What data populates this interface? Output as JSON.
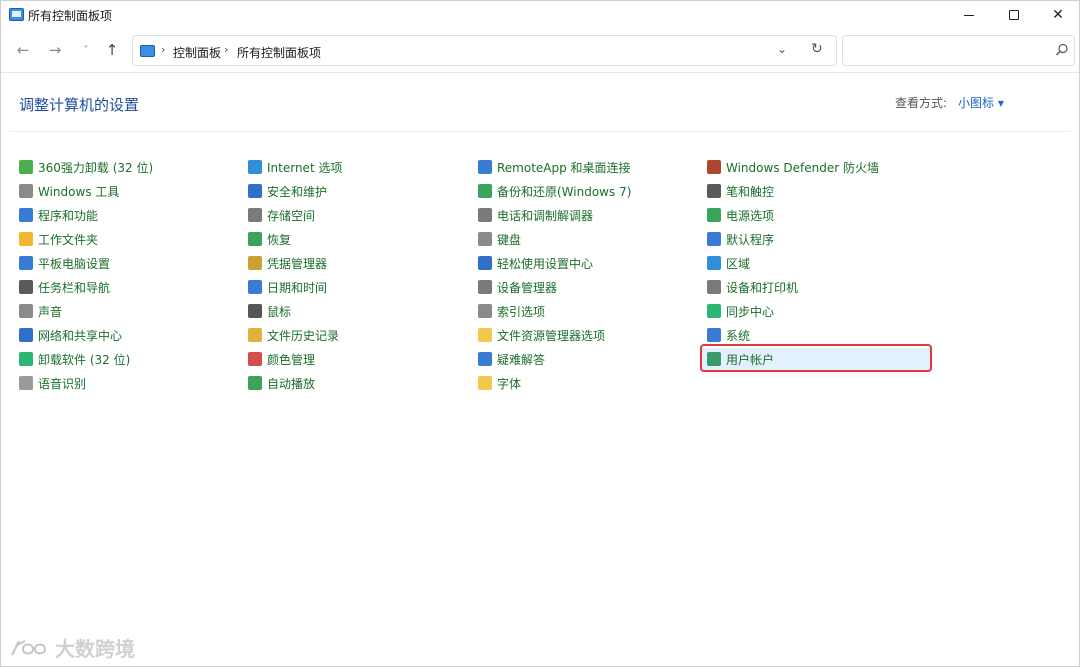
{
  "window": {
    "title": "所有控制面板项"
  },
  "nav": {
    "breadcrumb": [
      "控制面板",
      "所有控制面板项"
    ],
    "search_placeholder": ""
  },
  "main": {
    "heading": "调整计算机的设置",
    "view_label": "查看方式:",
    "view_value": "小图标 ▾"
  },
  "columns": [
    [
      {
        "label": "360强力卸载 (32 位)",
        "icon": "uninstall-360-icon",
        "color": "#4caf50"
      },
      {
        "label": "Windows 工具",
        "icon": "gear-icon",
        "color": "#8a8a8a"
      },
      {
        "label": "程序和功能",
        "icon": "programs-icon",
        "color": "#3a7bd5"
      },
      {
        "label": "工作文件夹",
        "icon": "work-folders-icon",
        "color": "#f2b632"
      },
      {
        "label": "平板电脑设置",
        "icon": "tablet-icon",
        "color": "#3a7bd5"
      },
      {
        "label": "任务栏和导航",
        "icon": "taskbar-icon",
        "color": "#5a5a5a"
      },
      {
        "label": "声音",
        "icon": "speaker-icon",
        "color": "#8a8a8a"
      },
      {
        "label": "网络和共享中心",
        "icon": "network-icon",
        "color": "#2f6fc9"
      },
      {
        "label": "卸载软件 (32 位)",
        "icon": "uninstall-software-icon",
        "color": "#2bb673"
      },
      {
        "label": "语音识别",
        "icon": "microphone-icon",
        "color": "#9a9a9a"
      }
    ],
    [
      {
        "label": "Internet 选项",
        "icon": "internet-options-icon",
        "color": "#2f8fd8"
      },
      {
        "label": "安全和维护",
        "icon": "flag-icon",
        "color": "#2f6fc9"
      },
      {
        "label": "存储空间",
        "icon": "storage-icon",
        "color": "#7a7a7a"
      },
      {
        "label": "恢复",
        "icon": "recovery-icon",
        "color": "#3aa55a"
      },
      {
        "label": "凭据管理器",
        "icon": "credential-icon",
        "color": "#c9a232"
      },
      {
        "label": "日期和时间",
        "icon": "clock-icon",
        "color": "#3a7bd5"
      },
      {
        "label": "鼠标",
        "icon": "mouse-icon",
        "color": "#555555"
      },
      {
        "label": "文件历史记录",
        "icon": "file-history-icon",
        "color": "#e2b33c"
      },
      {
        "label": "颜色管理",
        "icon": "color-management-icon",
        "color": "#d64b4b"
      },
      {
        "label": "自动播放",
        "icon": "autoplay-icon",
        "color": "#3aa55a"
      }
    ],
    [
      {
        "label": "RemoteApp 和桌面连接",
        "icon": "remoteapp-icon",
        "color": "#3a7bd5"
      },
      {
        "label": "备份和还原(Windows 7)",
        "icon": "backup-icon",
        "color": "#3aa55a"
      },
      {
        "label": "电话和调制解调器",
        "icon": "phone-icon",
        "color": "#7a7a7a"
      },
      {
        "label": "键盘",
        "icon": "keyboard-icon",
        "color": "#8a8a8a"
      },
      {
        "label": "轻松使用设置中心",
        "icon": "accessibility-icon",
        "color": "#2f6fc9"
      },
      {
        "label": "设备管理器",
        "icon": "device-manager-icon",
        "color": "#7a7a7a"
      },
      {
        "label": "索引选项",
        "icon": "index-icon",
        "color": "#8a8a8a"
      },
      {
        "label": "文件资源管理器选项",
        "icon": "folder-options-icon",
        "color": "#f2c94c"
      },
      {
        "label": "疑难解答",
        "icon": "troubleshoot-icon",
        "color": "#3a7bd5"
      },
      {
        "label": "字体",
        "icon": "font-icon",
        "color": "#f2c94c"
      }
    ],
    [
      {
        "label": "Windows Defender 防火墙",
        "icon": "firewall-icon",
        "color": "#b0462f"
      },
      {
        "label": "笔和触控",
        "icon": "pen-icon",
        "color": "#5a5a5a"
      },
      {
        "label": "电源选项",
        "icon": "power-icon",
        "color": "#3aa55a"
      },
      {
        "label": "默认程序",
        "icon": "default-programs-icon",
        "color": "#3a7bd5"
      },
      {
        "label": "区域",
        "icon": "globe-icon",
        "color": "#2f8fd8"
      },
      {
        "label": "设备和打印机",
        "icon": "printer-icon",
        "color": "#7a7a7a"
      },
      {
        "label": "同步中心",
        "icon": "sync-icon",
        "color": "#2bb673"
      },
      {
        "label": "系统",
        "icon": "computer-icon",
        "color": "#3a7bd5"
      },
      {
        "label": "用户帐户",
        "icon": "user-accounts-icon",
        "color": "#3a9a6a"
      }
    ]
  ],
  "highlighted_item": "用户帐户",
  "watermark": {
    "text": "大数跨境"
  }
}
